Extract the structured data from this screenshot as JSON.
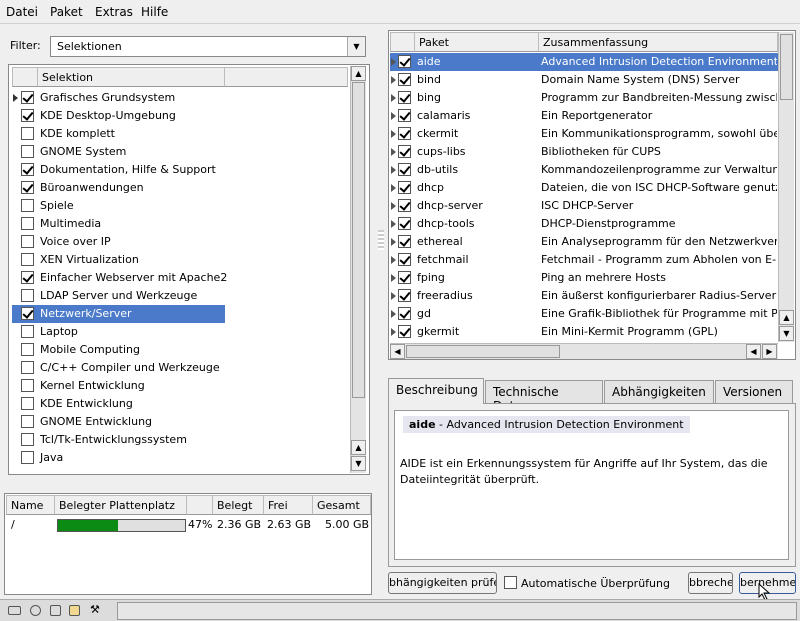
{
  "menu": [
    "Datei",
    "Paket",
    "Extras",
    "Hilfe"
  ],
  "filter": {
    "label": "Filter:",
    "value": "Selektionen"
  },
  "selections": {
    "header": "Selektion",
    "items": [
      {
        "label": "Grafisches Grundsystem",
        "checked": true,
        "marker": true
      },
      {
        "label": "KDE Desktop-Umgebung",
        "checked": true
      },
      {
        "label": "KDE komplett",
        "checked": false
      },
      {
        "label": "GNOME System",
        "checked": false
      },
      {
        "label": "Dokumentation, Hilfe & Support",
        "checked": true
      },
      {
        "label": "Büroanwendungen",
        "checked": true
      },
      {
        "label": "Spiele",
        "checked": false
      },
      {
        "label": "Multimedia",
        "checked": false
      },
      {
        "label": "Voice over IP",
        "checked": false
      },
      {
        "label": "XEN Virtualization",
        "checked": false
      },
      {
        "label": "Einfacher Webserver mit Apache2",
        "checked": true
      },
      {
        "label": "LDAP Server und Werkzeuge",
        "checked": false
      },
      {
        "label": "Netzwerk/Server",
        "checked": true,
        "selected": true
      },
      {
        "label": "Laptop",
        "checked": false
      },
      {
        "label": "Mobile Computing",
        "checked": false
      },
      {
        "label": "C/C++ Compiler und Werkzeuge",
        "checked": false
      },
      {
        "label": "Kernel Entwicklung",
        "checked": false
      },
      {
        "label": "KDE Entwicklung",
        "checked": false
      },
      {
        "label": "GNOME Entwicklung",
        "checked": false
      },
      {
        "label": "Tcl/Tk-Entwicklungssystem",
        "checked": false
      },
      {
        "label": "Java",
        "checked": false
      }
    ]
  },
  "disk": {
    "headers": [
      "Name",
      "Belegter Plattenplatz",
      "Belegt",
      "Frei",
      "Gesamt"
    ],
    "row": {
      "name": "/",
      "percent": "47%",
      "fraction": 0.47,
      "used": "2.36 GB",
      "free": "2.63 GB",
      "total": "5.00 GB"
    }
  },
  "packages": {
    "headers": [
      "Paket",
      "Zusammenfassung"
    ],
    "items": [
      {
        "name": "aide",
        "summary": "Advanced Intrusion Detection Environment",
        "selected": true
      },
      {
        "name": "bind",
        "summary": "Domain Name System (DNS) Server"
      },
      {
        "name": "bing",
        "summary": "Programm zur Bandbreiten-Messung zwisch"
      },
      {
        "name": "calamaris",
        "summary": "Ein Reportgenerator"
      },
      {
        "name": "ckermit",
        "summary": "Ein Kommunikationsprogramm, sowohl übe"
      },
      {
        "name": "cups-libs",
        "summary": "Bibliotheken für CUPS"
      },
      {
        "name": "db-utils",
        "summary": "Kommandozeilenprogramme zur Verwaltun"
      },
      {
        "name": "dhcp",
        "summary": "Dateien, die von ISC DHCP-Software genutzt"
      },
      {
        "name": "dhcp-server",
        "summary": "ISC DHCP-Server"
      },
      {
        "name": "dhcp-tools",
        "summary": "DHCP-Dienstprogramme"
      },
      {
        "name": "ethereal",
        "summary": "Ein Analyseprogramm für den Netzwerkverk"
      },
      {
        "name": "fetchmail",
        "summary": "Fetchmail - Programm zum Abholen von E-M"
      },
      {
        "name": "fping",
        "summary": "Ping an mehrere Hosts"
      },
      {
        "name": "freeradius",
        "summary": "Ein äußerst konfigurierbarer Radius-Server"
      },
      {
        "name": "gd",
        "summary": "Eine Grafik-Bibliothek für Programme mit PN"
      },
      {
        "name": "gkermit",
        "summary": "Ein Mini-Kermit Programm (GPL)"
      }
    ]
  },
  "tabs": [
    "Beschreibung",
    "Technische Daten",
    "Abhängigkeiten",
    "Versionen"
  ],
  "description": {
    "name": "aide",
    "title_rest": " - Advanced Intrusion Detection Environment",
    "body": "AIDE ist ein Erkennungssystem für Angriffe auf Ihr System, das die Dateiintegrität überprüft."
  },
  "buttons": {
    "check_deps": "bhängigkeiten prüfe",
    "auto_check": "Automatische Überprüfung",
    "cancel": "bbreche",
    "accept": "bernehme"
  }
}
